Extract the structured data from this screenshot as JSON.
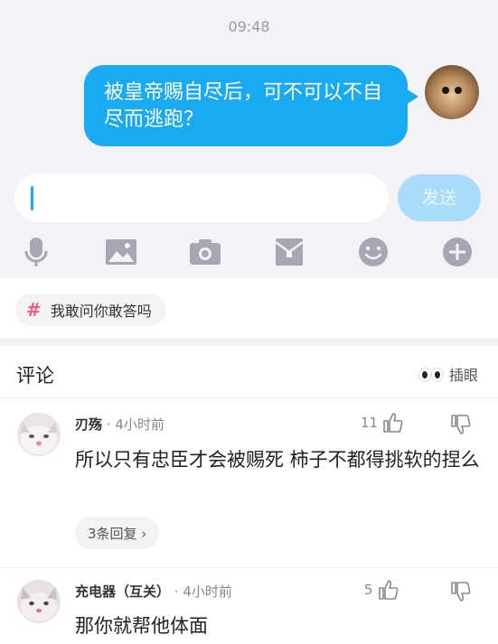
{
  "chat": {
    "time": "09:48",
    "message": "被皇帝赐自尽后，可不可以不自尽而逃跑？",
    "input_value": "",
    "send_label": "发送"
  },
  "toolbar": {
    "icons": [
      "microphone-icon",
      "image-icon",
      "camera-icon",
      "red-envelope-icon",
      "emoji-icon",
      "plus-icon"
    ]
  },
  "topic": {
    "hash": "#",
    "label": "我敢问你敢答吗"
  },
  "comments_section": {
    "title": "评论",
    "peek_label": "插眼"
  },
  "comments": [
    {
      "name": "刃殇",
      "time": "· 4小时前",
      "likes": "11",
      "text": "所以只有忠臣才会被赐死  柿子不都得挑软的捏么",
      "reply_label": "3条回复 ›"
    },
    {
      "name": "充电器（互关）",
      "time": "· 4小时前",
      "likes": "5",
      "text": "那你就帮他体面"
    }
  ],
  "colors": {
    "accent": "#1aaaf2",
    "send_disabled": "#a9dcfa",
    "tag_hash": "#ef5f8b",
    "icon_gray": "#a6a6b5"
  }
}
